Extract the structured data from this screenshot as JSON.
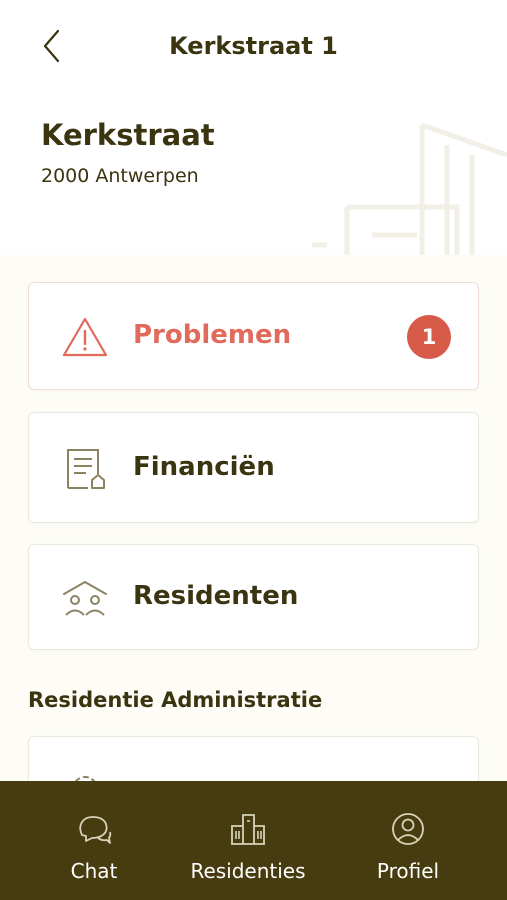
{
  "nav": {
    "title": "Kerkstraat 1",
    "back_icon": "chevron-left-icon"
  },
  "address": {
    "street": "Kerkstraat",
    "city": "2000 Antwerpen"
  },
  "cards": [
    {
      "label": "Problemen",
      "icon": "warning-triangle-icon",
      "badge": "1",
      "color": "#e06a5b"
    },
    {
      "label": "Financiën",
      "icon": "document-house-icon"
    },
    {
      "label": "Residenten",
      "icon": "residents-icon"
    }
  ],
  "section": {
    "title": "Residentie Administratie",
    "partial_card_icon": "gear-icon"
  },
  "tabbar": {
    "items": [
      {
        "label": "Chat",
        "icon": "chat-bubbles-icon"
      },
      {
        "label": "Residenties",
        "icon": "buildings-icon"
      },
      {
        "label": "Profiel",
        "icon": "user-circle-icon"
      }
    ]
  },
  "colors": {
    "brand_dark": "#473c0f",
    "text": "#3a3410",
    "alert": "#e06a5b",
    "badge": "#d85a48",
    "background": "#fdfcf6",
    "icon": "#8b8262"
  }
}
